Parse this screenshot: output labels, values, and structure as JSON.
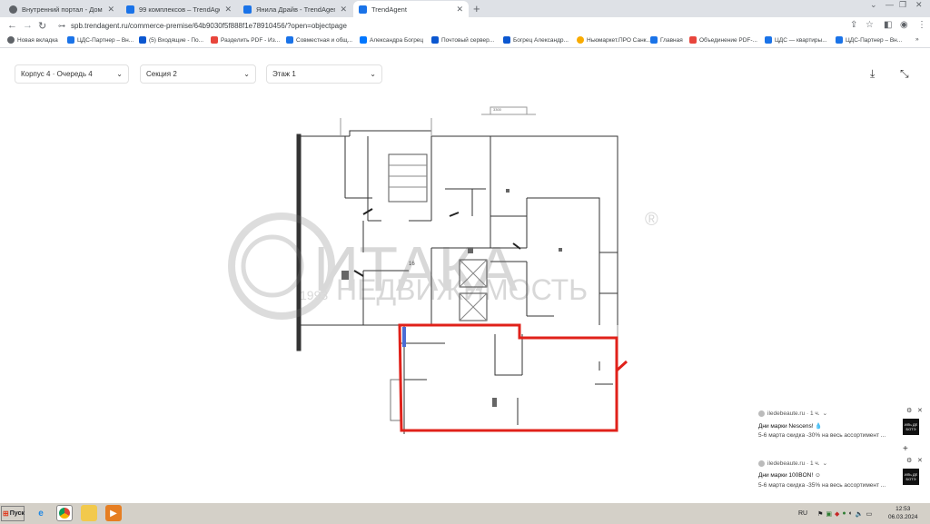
{
  "browser": {
    "tabs": [
      {
        "title": "Внутренний портал - Домашн...",
        "color": "#5f6368"
      },
      {
        "title": "99 комплексов – TrendAgent",
        "color": "#1a73e8"
      },
      {
        "title": "Янила Драйв - TrendAgent",
        "color": "#1a73e8"
      },
      {
        "title": "TrendAgent",
        "color": "#1a73e8"
      }
    ],
    "url": "spb.trendagent.ru/commerce-premise/64b9030f5f888f1e78910456/?open=objectpage",
    "bookmarks": [
      {
        "label": "Новая вкладка",
        "color": "#5f6368"
      },
      {
        "label": "ЦДС-Партнер – Вн...",
        "color": "#1a73e8"
      },
      {
        "label": "(5) Входящие - По...",
        "color": "#0b57d0"
      },
      {
        "label": "Разделить PDF - Из...",
        "color": "#e8453c"
      },
      {
        "label": "Совместная и общ...",
        "color": "#1a73e8"
      },
      {
        "label": "Александра Богрец",
        "color": "#0077ff"
      },
      {
        "label": "Почтовый сервер...",
        "color": "#0b57d0"
      },
      {
        "label": "Богрец Александр...",
        "color": "#0b57d0"
      },
      {
        "label": "Ньюмаркет.ПРО Санк...",
        "color": "#f9ab00"
      },
      {
        "label": "Главная",
        "color": "#1a73e8"
      },
      {
        "label": "Объединение PDF-...",
        "color": "#e8453c"
      },
      {
        "label": "ЦДС — квартиры...",
        "color": "#1a73e8"
      },
      {
        "label": "ЦДС-Партнер – Вн...",
        "color": "#1a73e8"
      }
    ]
  },
  "page": {
    "filters": {
      "building": "Корпус 4 · Очередь 4",
      "section": "Секция 2",
      "floor": "Этаж 1"
    },
    "plan": {
      "watermark": "ИТАКА",
      "watermark_sub": "НЕДВИЖИМОСТЬ",
      "watermark_year": "1993",
      "watermark_reg": "®",
      "dim_label": "3300",
      "room_label": "16",
      "highlight_color": "#e0211a"
    }
  },
  "notifications": [
    {
      "source": "iledebeaute.ru · 1 ч.",
      "title": "Дни марки Nescens! 💧",
      "text": "5-6 марта скидка -30% на весь ассортимент ...",
      "badge": "ИЛЬ ДЕ БОТЭ"
    },
    {
      "source": "iledebeaute.ru · 1 ч.",
      "title": "Дни марки 100BON! ☺",
      "text": "5-6 марта скидка -35% на весь ассортимент ...",
      "badge": "ИЛЬ ДЕ БОТЭ"
    }
  ],
  "taskbar": {
    "start": "Пуск",
    "lang": "RU",
    "time": "12:53",
    "date": "06.03.2024"
  }
}
